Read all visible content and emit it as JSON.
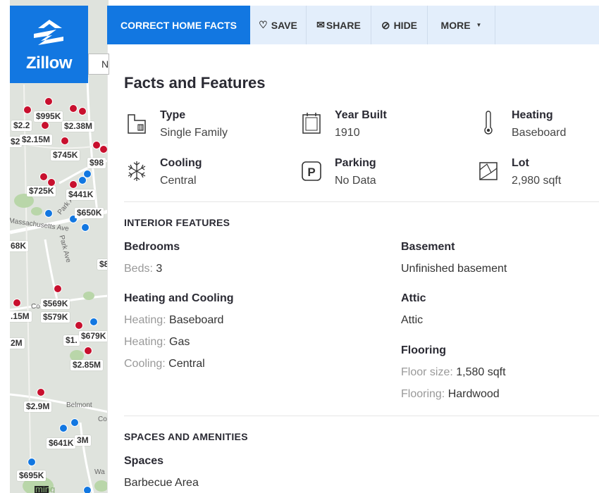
{
  "app": {
    "logo_text": "Zillow"
  },
  "map": {
    "search_partial": "N",
    "prices": [
      "$995K",
      "$2.2",
      "$2.38M",
      "$2",
      "$2.15M",
      "$745K",
      "$98",
      "$725K",
      "$441K",
      "$650K",
      "68K",
      "$8",
      "$569K",
      ".15M",
      "$579K",
      "2M",
      "$1.",
      "$679K",
      "$2.85M",
      "$2.9M",
      "$641K",
      "3M",
      "$695K"
    ],
    "streets": [
      "Massachusetts Ave",
      "Park Ave",
      "Belmont",
      "Co",
      "Wa",
      "Co",
      "Park Av",
      "ming"
    ]
  },
  "toolbar": {
    "correct": "CORRECT HOME FACTS",
    "save": "SAVE",
    "share": "SHARE",
    "hide": "HIDE",
    "more": "MORE"
  },
  "panel": {
    "title": "Facts and Features",
    "facts": [
      {
        "label": "Type",
        "value": "Single Family",
        "icon": "house-icon"
      },
      {
        "label": "Year Built",
        "value": "1910",
        "icon": "calendar-icon"
      },
      {
        "label": "Heating",
        "value": "Baseboard",
        "icon": "thermometer-icon"
      },
      {
        "label": "Cooling",
        "value": "Central",
        "icon": "snowflake-icon"
      },
      {
        "label": "Parking",
        "value": "No Data",
        "icon": "parking-icon"
      },
      {
        "label": "Lot",
        "value": "2,980 sqft",
        "icon": "lot-icon"
      }
    ],
    "interior": {
      "title": "INTERIOR FEATURES",
      "bedrooms": {
        "title": "Bedrooms",
        "rows": [
          {
            "k": "Beds:",
            "v": "3"
          }
        ]
      },
      "heating_cooling": {
        "title": "Heating and Cooling",
        "rows": [
          {
            "k": "Heating:",
            "v": "Baseboard"
          },
          {
            "k": "Heating:",
            "v": "Gas"
          },
          {
            "k": "Cooling:",
            "v": "Central"
          }
        ]
      },
      "basement": {
        "title": "Basement",
        "value": "Unfinished basement"
      },
      "attic": {
        "title": "Attic",
        "value": "Attic"
      },
      "flooring": {
        "title": "Flooring",
        "rows": [
          {
            "k": "Floor size:",
            "v": "1,580 sqft"
          },
          {
            "k": "Flooring:",
            "v": "Hardwood"
          }
        ]
      }
    },
    "spaces": {
      "title": "SPACES AND AMENITIES",
      "sub": "Spaces",
      "value": "Barbecue Area"
    }
  },
  "colors": {
    "brand": "#1277e1",
    "toolbar_bg": "#e3eefb",
    "pin_red": "#c8102e",
    "pin_blue": "#1277e1"
  }
}
